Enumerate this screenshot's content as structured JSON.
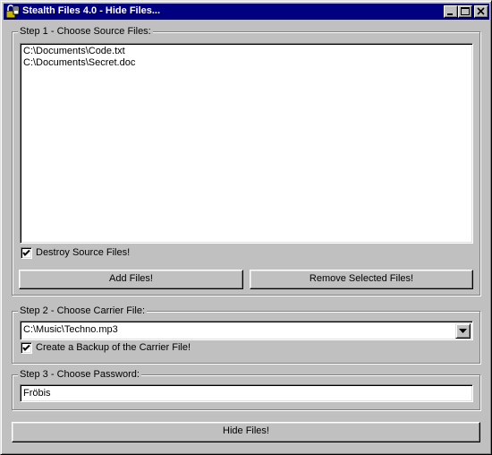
{
  "window": {
    "title": "Stealth Files 4.0 - Hide Files...",
    "icon": "lock-icon"
  },
  "step1": {
    "label": "Step 1 - Choose Source Files:",
    "files": [
      "C:\\Documents\\Code.txt",
      "C:\\Documents\\Secret.doc"
    ],
    "destroy_label": "Destroy Source Files!",
    "destroy_checked": true,
    "add_label": "Add Files!",
    "remove_label": "Remove Selected Files!"
  },
  "step2": {
    "label": "Step 2 - Choose Carrier File:",
    "carrier_value": "C:\\Music\\Techno.mp3",
    "backup_label": "Create a Backup of the Carrier File!",
    "backup_checked": true
  },
  "step3": {
    "label": "Step 3 - Choose Password:",
    "password_value": "Fröbis"
  },
  "actions": {
    "hide_label": "Hide Files!"
  }
}
